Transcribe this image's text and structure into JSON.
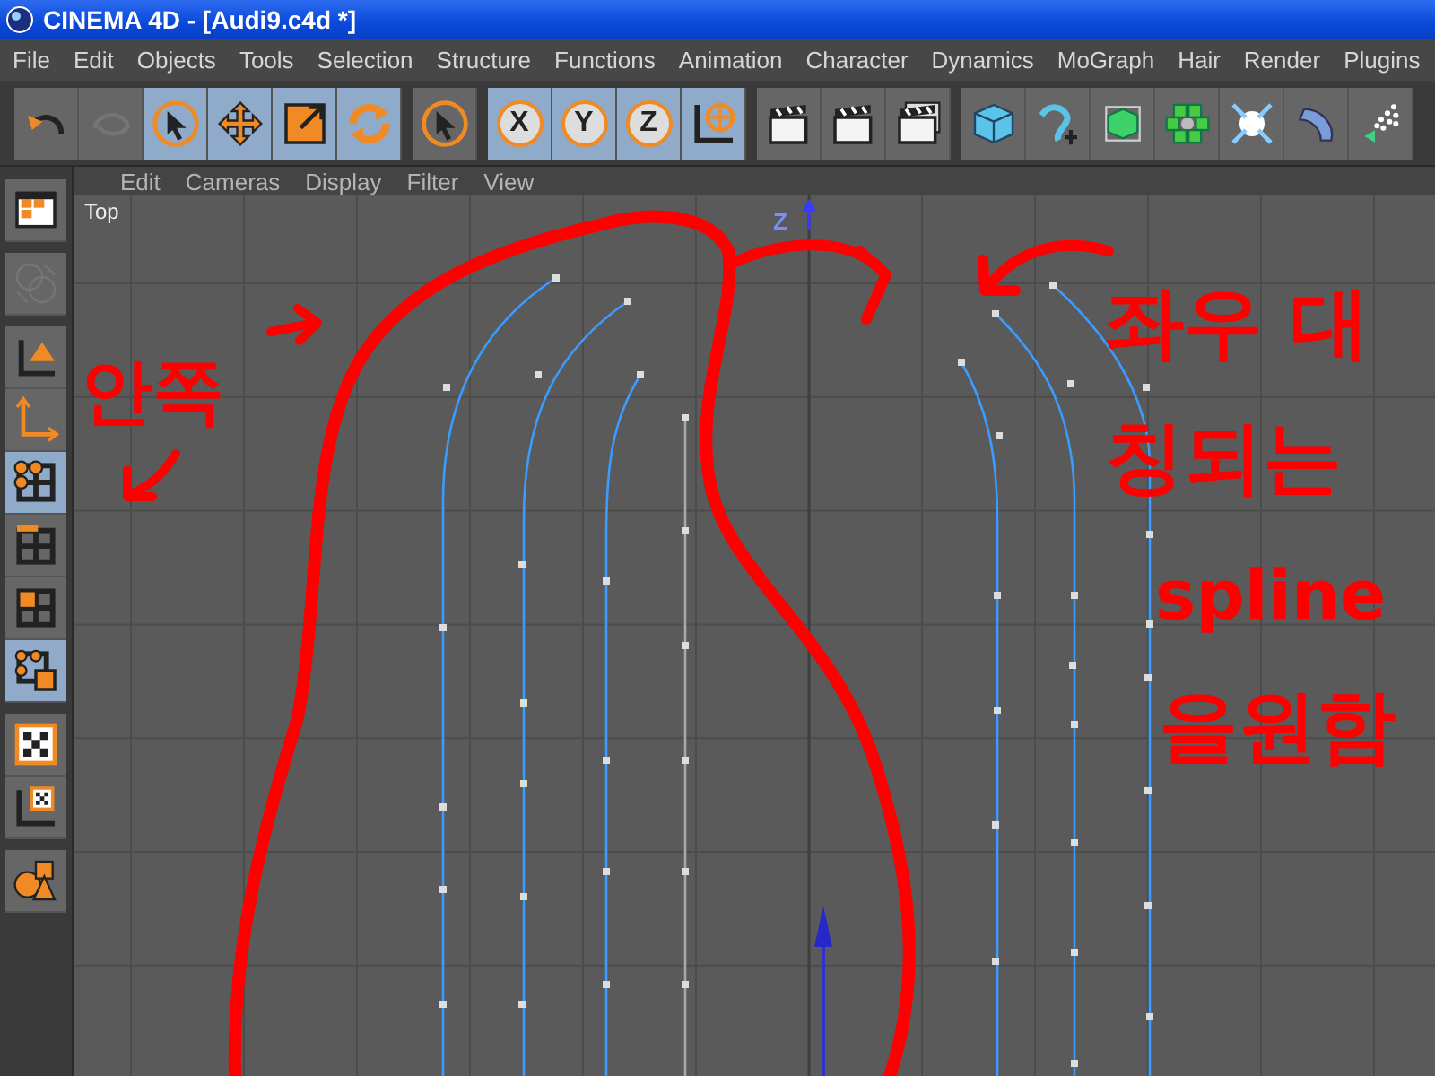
{
  "window": {
    "title": "CINEMA 4D - [Audi9.c4d *]"
  },
  "menu": [
    "File",
    "Edit",
    "Objects",
    "Tools",
    "Selection",
    "Structure",
    "Functions",
    "Animation",
    "Character",
    "Dynamics",
    "MoGraph",
    "Hair",
    "Render",
    "Plugins"
  ],
  "toolbar": [
    [
      {
        "kind": "undo",
        "selected": false,
        "disabled": false
      },
      {
        "kind": "redo",
        "selected": false,
        "disabled": true
      },
      {
        "kind": "cursor",
        "selected": true,
        "disabled": false
      },
      {
        "kind": "move",
        "selected": true,
        "disabled": false
      },
      {
        "kind": "scale",
        "selected": true,
        "disabled": false
      },
      {
        "kind": "rotate",
        "selected": true,
        "disabled": false
      }
    ],
    [
      {
        "kind": "cursor",
        "selected": false,
        "disabled": false
      }
    ],
    [
      {
        "kind": "axis",
        "label": "X",
        "selected": true,
        "disabled": false
      },
      {
        "kind": "axis",
        "label": "Y",
        "selected": true,
        "disabled": false
      },
      {
        "kind": "axis",
        "label": "Z",
        "selected": true,
        "disabled": false
      },
      {
        "kind": "world",
        "selected": true,
        "disabled": false
      }
    ],
    [
      {
        "kind": "clapper_view",
        "selected": false,
        "disabled": false
      },
      {
        "kind": "clapper",
        "selected": false,
        "disabled": false
      },
      {
        "kind": "clapper_multi",
        "selected": false,
        "disabled": false
      }
    ],
    [
      {
        "kind": "cube",
        "selected": false,
        "disabled": false
      },
      {
        "kind": "spline_pen",
        "selected": false,
        "disabled": false
      },
      {
        "kind": "subdiv_cube",
        "selected": false,
        "disabled": false
      },
      {
        "kind": "cluster",
        "selected": false,
        "disabled": false
      },
      {
        "kind": "expand",
        "selected": false,
        "disabled": false
      },
      {
        "kind": "disc",
        "selected": false,
        "disabled": false
      },
      {
        "kind": "particles",
        "selected": false,
        "disabled": false
      }
    ]
  ],
  "side_toolbar": [
    [
      {
        "kind": "layout",
        "selected": false,
        "disabled": false
      }
    ],
    [
      {
        "kind": "globe",
        "selected": false,
        "disabled": true
      }
    ],
    [
      {
        "kind": "model",
        "selected": false,
        "disabled": false
      },
      {
        "kind": "object_axis",
        "selected": false,
        "disabled": false
      },
      {
        "kind": "points",
        "selected": true,
        "disabled": false
      },
      {
        "kind": "edges",
        "selected": false,
        "disabled": false
      },
      {
        "kind": "polygons",
        "selected": false,
        "disabled": false
      },
      {
        "kind": "uv_points",
        "selected": true,
        "disabled": false
      }
    ],
    [
      {
        "kind": "texture",
        "selected": false,
        "disabled": false
      },
      {
        "kind": "texture_axis",
        "selected": false,
        "disabled": false
      }
    ],
    [
      {
        "kind": "primitives",
        "selected": false,
        "disabled": false
      }
    ]
  ],
  "viewport": {
    "menu": [
      "Edit",
      "Cameras",
      "Display",
      "Filter",
      "View"
    ],
    "view_label": "Top",
    "axis_label": "Z"
  },
  "annotations": {
    "left_note": "안쪽",
    "right_note": [
      "좌우 대",
      "칭되는",
      "spline",
      "을원함"
    ]
  }
}
